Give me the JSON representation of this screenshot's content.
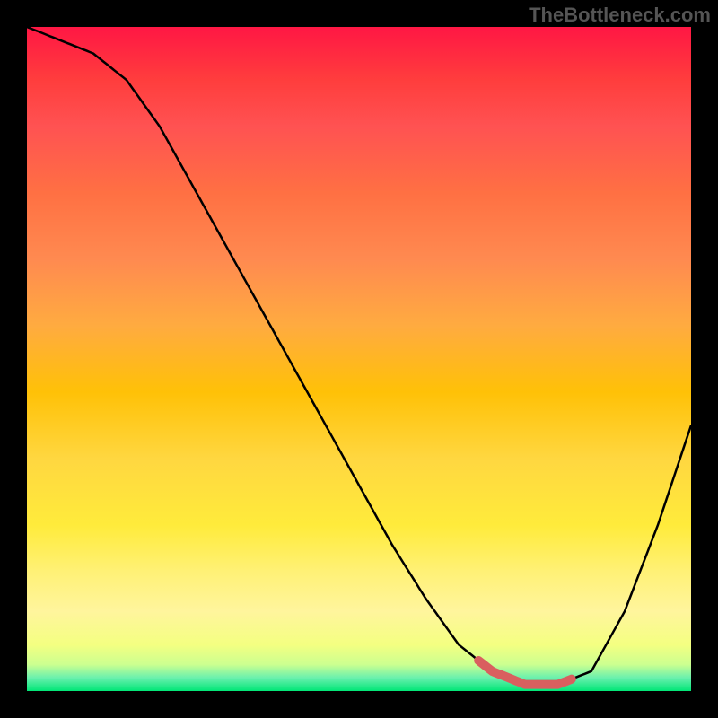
{
  "watermark": "TheBottleneck.com",
  "chart_data": {
    "type": "line",
    "title": "",
    "xlabel": "",
    "ylabel": "",
    "xlim": [
      0,
      100
    ],
    "ylim": [
      0,
      100
    ],
    "series": [
      {
        "name": "bottleneck-curve",
        "x": [
          0,
          5,
          10,
          15,
          20,
          25,
          30,
          35,
          40,
          45,
          50,
          55,
          60,
          65,
          70,
          75,
          80,
          85,
          90,
          95,
          100
        ],
        "values": [
          100,
          98,
          96,
          92,
          85,
          76,
          67,
          58,
          49,
          40,
          31,
          22,
          14,
          7,
          3,
          1,
          1,
          3,
          12,
          25,
          40
        ]
      }
    ],
    "highlight": {
      "name": "optimal-range",
      "x_start": 68,
      "x_end": 82,
      "color": "#d95f5f"
    },
    "gradient_colors": {
      "top": "#ff1744",
      "mid": "#ffeb3b",
      "bottom": "#00e676"
    }
  }
}
